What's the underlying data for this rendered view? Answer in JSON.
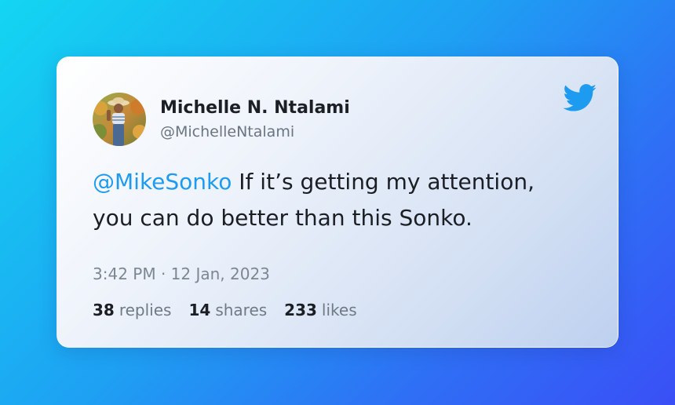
{
  "tweet": {
    "author_name": "Michelle N. Ntalami",
    "author_handle": "@MichelleNtalami",
    "mention": "@MikeSonko",
    "body_line1": " If it’s getting my attention,",
    "body_line2": "you can do better than this Sonko.",
    "timestamp": "3:42 PM · 12 Jan, 2023",
    "stats": {
      "replies_count": "38",
      "replies_label": "replies",
      "shares_count": "14",
      "shares_label": "shares",
      "likes_count": "233",
      "likes_label": "likes"
    }
  },
  "icons": {
    "brand": "twitter-bird-icon"
  },
  "colors": {
    "accent": "#1d9bf0",
    "background_start": "#13d6f2",
    "background_end": "#3a4ff6"
  }
}
